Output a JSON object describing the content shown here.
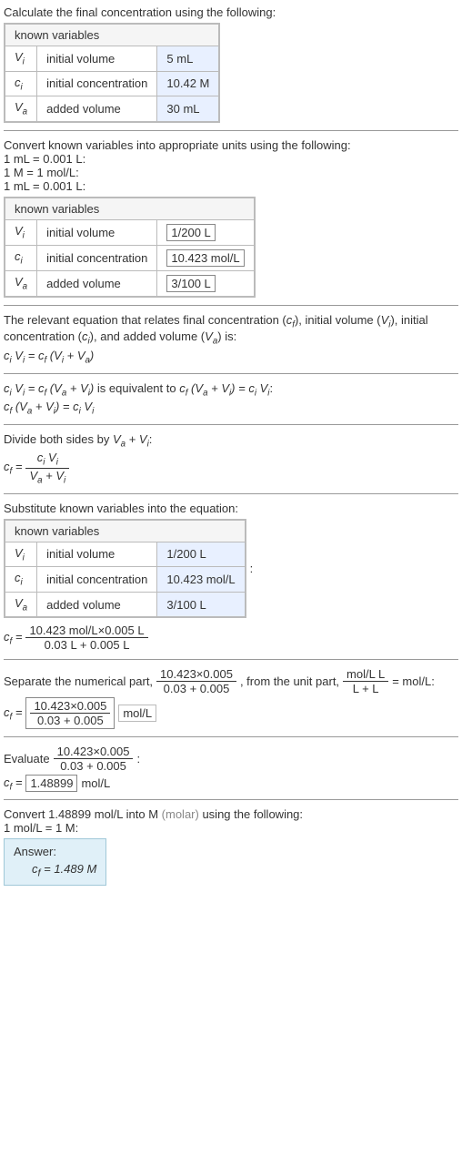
{
  "step1": {
    "intro": "Calculate the final concentration using the following:",
    "header": "known variables",
    "rows": [
      {
        "sym": "V",
        "sub": "i",
        "desc": "initial volume",
        "val": "5 mL"
      },
      {
        "sym": "c",
        "sub": "i",
        "desc": "initial concentration",
        "val": "10.42 M"
      },
      {
        "sym": "V",
        "sub": "a",
        "desc": "added volume",
        "val": "30 mL"
      }
    ]
  },
  "step2": {
    "intro": "Convert known variables into appropriate units using the following:",
    "conv1": "1 mL = 0.001 L:",
    "conv2": "1 M = 1 mol/L:",
    "conv3": "1 mL = 0.001 L:",
    "header": "known variables",
    "rows": [
      {
        "sym": "V",
        "sub": "i",
        "desc": "initial volume",
        "val": "1/200 L"
      },
      {
        "sym": "c",
        "sub": "i",
        "desc": "initial concentration",
        "val": "10.423 mol/L"
      },
      {
        "sym": "V",
        "sub": "a",
        "desc": "added volume",
        "val": "3/100 L"
      }
    ]
  },
  "step3": {
    "intro_a": "The relevant equation that relates final concentration (",
    "intro_b": "), initial volume (",
    "intro_c": "), initial concentration (",
    "intro_d": "), and added volume (",
    "intro_e": ") is:",
    "cf": "c",
    "cfs": "f",
    "Vi": "V",
    "Vis": "i",
    "ci": "c",
    "cis": "i",
    "Va": "V",
    "Vas": "a",
    "eq": "cᵢ Vᵢ = c_f (Vᵢ + Vₐ)"
  },
  "step4": {
    "text_a": "cᵢ Vᵢ = c_f (Vₐ + Vᵢ)",
    "text_mid": " is equivalent to ",
    "text_b": "c_f (Vₐ + Vᵢ) = cᵢ Vᵢ",
    "colon": ":",
    "eq": "c_f (Vₐ + Vᵢ) = cᵢ Vᵢ"
  },
  "step5": {
    "intro": "Divide both sides by ",
    "by": "Vₐ + Vᵢ",
    "colon": ":",
    "lhs": "c_f = ",
    "num": "cᵢ Vᵢ",
    "den": "Vₐ + Vᵢ"
  },
  "step6": {
    "intro": "Substitute known variables into the equation:",
    "header": "known variables",
    "rows": [
      {
        "sym": "V",
        "sub": "i",
        "desc": "initial volume",
        "val": "1/200 L"
      },
      {
        "sym": "c",
        "sub": "i",
        "desc": "initial concentration",
        "val": "10.423 mol/L"
      },
      {
        "sym": "V",
        "sub": "a",
        "desc": "added volume",
        "val": "3/100 L"
      }
    ],
    "colon": ":",
    "lhs": "c_f = ",
    "num": "10.423 mol/L×0.005 L",
    "den": "0.03 L + 0.005 L"
  },
  "step7": {
    "a": "Separate the numerical part, ",
    "numA": "10.423×0.005",
    "denA": "0.03 + 0.005",
    "b": ", from the unit part, ",
    "numB": "mol/L L",
    "denB": "L + L",
    "c": " = mol/L:",
    "lhs": "c_f = ",
    "boxNum": "10.423×0.005",
    "boxDen": "0.03 + 0.005",
    "unit": "mol/L"
  },
  "step8": {
    "a": "Evaluate ",
    "num": "10.423×0.005",
    "den": "0.03 + 0.005",
    "colon": ":",
    "lhs": "c_f = ",
    "val": "1.48899",
    "unit": " mol/L"
  },
  "step9": {
    "a": "Convert 1.48899 mol/L into M ",
    "gray": "(molar)",
    "b": " using the following:",
    "conv": "1 mol/L = 1 M:",
    "ansLabel": "Answer:",
    "ansEq": "c_f = 1.489 M"
  }
}
